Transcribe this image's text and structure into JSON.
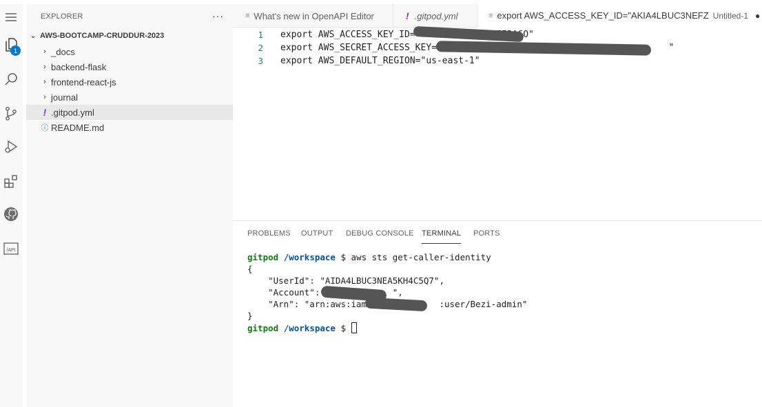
{
  "activity_bar": {
    "explorer_badge": "1",
    "items": [
      "menu-icon",
      "files-icon",
      "search-icon",
      "source-control-icon",
      "run-debug-icon",
      "extensions-icon",
      "github-icon",
      "api-icon"
    ],
    "api_label": "/API"
  },
  "sidebar": {
    "title": "EXPLORER",
    "more": "···",
    "root": "AWS-BOOTCAMP-CRUDDUR-2023",
    "items": [
      {
        "label": "_docs",
        "icon": "chevron-right-icon",
        "glyph": "›"
      },
      {
        "label": "backend-flask",
        "icon": "chevron-right-icon",
        "glyph": "›"
      },
      {
        "label": "frontend-react-js",
        "icon": "chevron-right-icon",
        "glyph": "›"
      },
      {
        "label": "journal",
        "icon": "chevron-right-icon",
        "glyph": "›"
      },
      {
        "label": ".gitpod.yml",
        "icon": "yaml-exclamation-icon",
        "glyph": "!"
      },
      {
        "label": "README.md",
        "icon": "info-icon",
        "glyph": "ⓘ"
      }
    ]
  },
  "tabs": [
    {
      "label": "What's new in OpenAPI Editor"
    },
    {
      "label": ".gitpod.yml"
    },
    {
      "label": "export AWS_ACCESS_KEY_ID=\"AKIA4LBUC3NEFZ",
      "sub": "Untitled-1",
      "dirty": "●"
    }
  ],
  "editor": {
    "lines": [
      {
        "num": "1",
        "text": "export AWS_ACCESS_KEY_ID=\"              7I3A6O\""
      },
      {
        "num": "2",
        "text": "export AWS_SECRET_ACCESS_KEY=\"                                          \""
      },
      {
        "num": "3",
        "text": "export AWS_DEFAULT_REGION=\"us-east-1\""
      }
    ]
  },
  "panel": {
    "tabs": [
      "PROBLEMS",
      "OUTPUT",
      "DEBUG CONSOLE",
      "TERMINAL",
      "PORTS"
    ],
    "active_tab": "TERMINAL",
    "terminal": {
      "prompt_user": "gitpod",
      "prompt_dir": "/workspace",
      "prompt_symbol": "$",
      "command": "aws sts get-caller-identity",
      "output": [
        "{",
        "    \"UserId\": \"AIDA4LBUC3NEA5KH4C5Q7\",",
        "    \"Account\": \"            \",",
        "    \"Arn\": \"arn:aws:iam::            :user/Bezi-admin\"",
        "}"
      ]
    }
  },
  "colors": {
    "accent": "#0078d4",
    "prompt_user": "#107c10",
    "prompt_dir": "#0451a5",
    "line_number": "#237893",
    "yaml_icon": "#6a3dc7"
  }
}
